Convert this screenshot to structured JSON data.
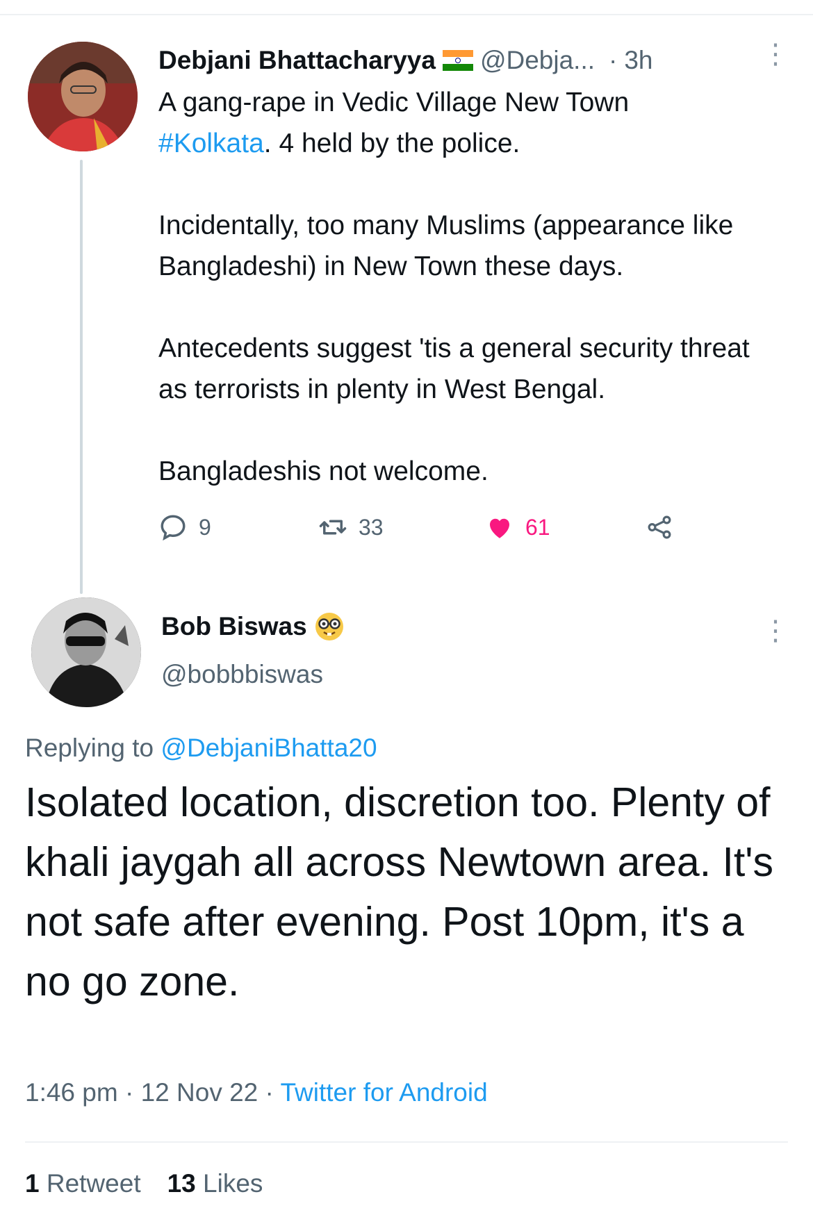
{
  "parent_tweet": {
    "author_name": "Debjani Bhattacharyya",
    "author_flag_icon": "india-flag-icon",
    "handle": "@Debja...",
    "time": "3h",
    "text_line1": "A gang-rape in Vedic Village New Town",
    "hashtag": "#Kolkata",
    "text_line2_rest": ". 4 held by the police.",
    "paragraph2": "Incidentally, too many Muslims (appearance like Bangladeshi) in New Town these days.",
    "paragraph3": "Antecedents suggest 'tis a general security threat as terrorists in plenty in West Bengal.",
    "paragraph4": "Bangladeshis not welcome.",
    "replies": "9",
    "retweets": "33",
    "likes": "61",
    "like_color": "#f91880"
  },
  "reply_tweet": {
    "author_name": "Bob Biswas",
    "handle": "@bobbbiswas",
    "replying_prefix": "Replying to",
    "replying_to": "@DebjaniBhatta20",
    "text": "Isolated location, discretion too. Plenty of khali jaygah all across Newtown area. It's not safe after evening. Post 10pm, it's a no go zone.",
    "time": "1:46 pm",
    "separator": "·",
    "date": "12 Nov 22",
    "source": "Twitter for Android",
    "retweet_count": "1",
    "retweet_label": "Retweet",
    "likes_count": "13",
    "likes_label": "Likes"
  },
  "colors": {
    "link": "#1d9bf0",
    "secondary_text": "#536471",
    "primary_text": "#0f1419"
  }
}
